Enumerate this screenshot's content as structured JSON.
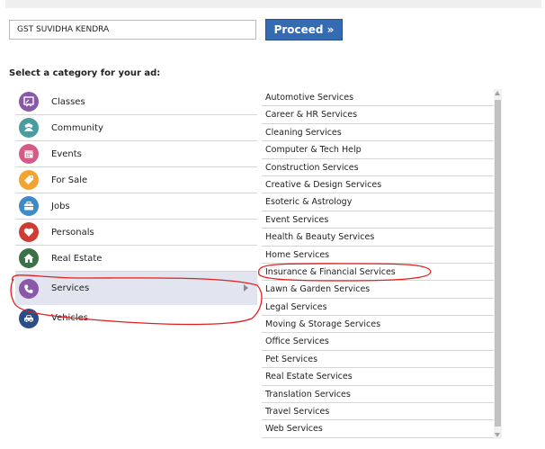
{
  "search": {
    "value": "GST SUVIDHA KENDRA"
  },
  "proceed_label": "Proceed »",
  "heading": "Select a category for your ad:",
  "categories": [
    {
      "label": "Classes",
      "icon": "board-icon",
      "color": "#8a58a8"
    },
    {
      "label": "Community",
      "icon": "people-icon",
      "color": "#4a9ca0"
    },
    {
      "label": "Events",
      "icon": "calendar-icon",
      "color": "#d45b86"
    },
    {
      "label": "For Sale",
      "icon": "tag-icon",
      "color": "#f0a532"
    },
    {
      "label": "Jobs",
      "icon": "briefcase-icon",
      "color": "#3d8bc7"
    },
    {
      "label": "Personals",
      "icon": "heart-icon",
      "color": "#cf3c33"
    },
    {
      "label": "Real Estate",
      "icon": "house-icon",
      "color": "#3c7047"
    },
    {
      "label": "Services",
      "icon": "phone-icon",
      "color": "#8a58a8"
    },
    {
      "label": "Vehicles",
      "icon": "car-icon",
      "color": "#2c4e88"
    }
  ],
  "subcategories": [
    "Automotive Services",
    "Career & HR Services",
    "Cleaning Services",
    "Computer & Tech Help",
    "Construction Services",
    "Creative & Design Services",
    "Esoteric & Astrology",
    "Event Services",
    "Health & Beauty Services",
    "Home Services",
    "Insurance & Financial Services",
    "Lawn & Garden Services",
    "Legal Services",
    "Moving & Storage Services",
    "Office Services",
    "Pet Services",
    "Real Estate Services",
    "Translation Services",
    "Travel Services",
    "Web Services"
  ],
  "annotation_color": "#e02020"
}
